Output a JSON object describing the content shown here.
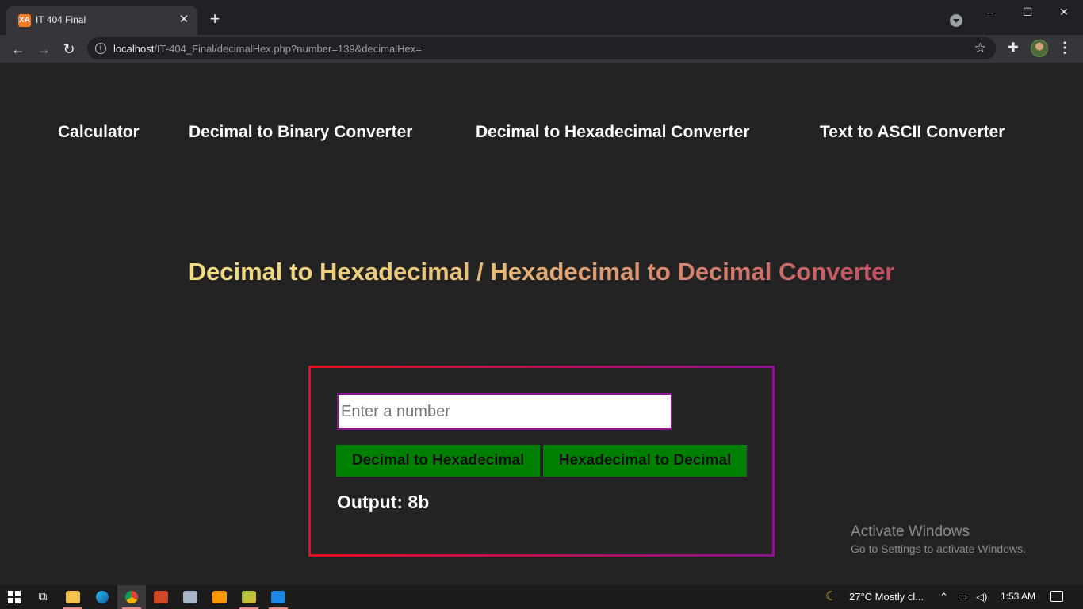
{
  "browser": {
    "tab_title": "IT 404 Final",
    "favicon_text": "XA",
    "url_host": "localhost",
    "url_path": "/IT-404_Final/decimalHex.php?number=139&decimalHex="
  },
  "nav": {
    "items": [
      {
        "label": "Calculator"
      },
      {
        "label": "Decimal to Binary Converter"
      },
      {
        "label": "Decimal to Hexadecimal Converter"
      },
      {
        "label": "Text to ASCII Converter"
      }
    ]
  },
  "main": {
    "title": "Decimal to Hexadecimal / Hexadecimal to Decimal Converter",
    "input_value": "",
    "input_placeholder": "Enter a number",
    "buttons": {
      "dec_to_hex": "Decimal to Hexadecimal",
      "hex_to_dec": "Hexadecimal to Decimal"
    },
    "output": "Output: 8b"
  },
  "watermark": {
    "title": "Activate Windows",
    "subtitle": "Go to Settings to activate Windows."
  },
  "taskbar": {
    "weather": "27°C  Mostly cl...",
    "clock": "1:53 AM"
  },
  "colors": {
    "page_bg": "#232323",
    "button_green": "#008000",
    "box_border_start": "#e3101e",
    "box_border_end": "#8a158e",
    "title_gradient_start": "#f3de83",
    "title_gradient_end": "#c24d5f"
  }
}
